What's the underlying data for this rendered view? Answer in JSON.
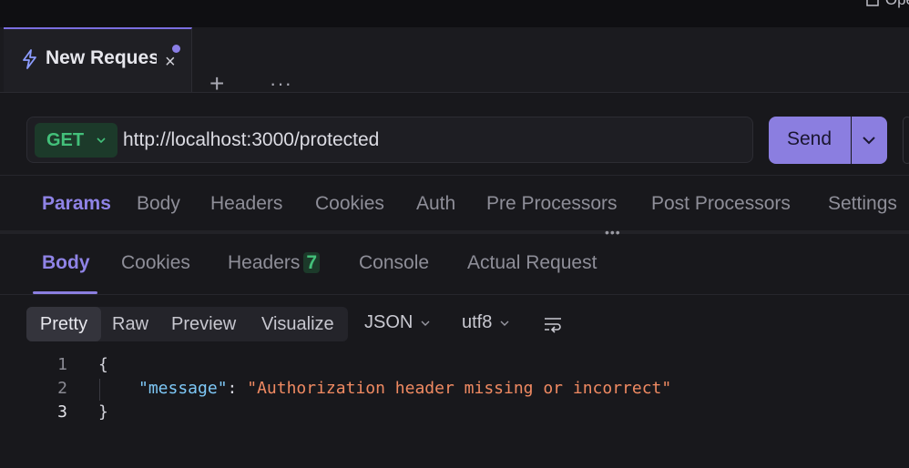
{
  "topbar": {
    "open_label": "Ope"
  },
  "tab": {
    "name": "New Request",
    "close": "×"
  },
  "tabstrip": {
    "add": "+",
    "more": "···"
  },
  "request": {
    "method": "GET",
    "url": "http://localhost:3000/protected",
    "send_label": "Send"
  },
  "request_tabs": [
    "Params",
    "Body",
    "Headers",
    "Cookies",
    "Auth",
    "Pre Processors",
    "Post Processors",
    "Settings"
  ],
  "response_tabs": {
    "body": "Body",
    "cookies": "Cookies",
    "headers": "Headers",
    "headers_count": "7",
    "console": "Console",
    "actual_request": "Actual Request"
  },
  "view_modes": [
    "Pretty",
    "Raw",
    "Preview",
    "Visualize"
  ],
  "format": {
    "type": "JSON",
    "encoding": "utf8"
  },
  "code": {
    "line_numbers": [
      "1",
      "2",
      "3"
    ],
    "open_brace": "{",
    "key": "\"message\"",
    "colon": ": ",
    "value": "\"Authorization header missing or incorrect\"",
    "close_brace": "}"
  },
  "colors": {
    "accent": "#8b7ee0",
    "method_green": "#43c07a",
    "json_key": "#7ec8f7",
    "json_string": "#f08a62"
  }
}
